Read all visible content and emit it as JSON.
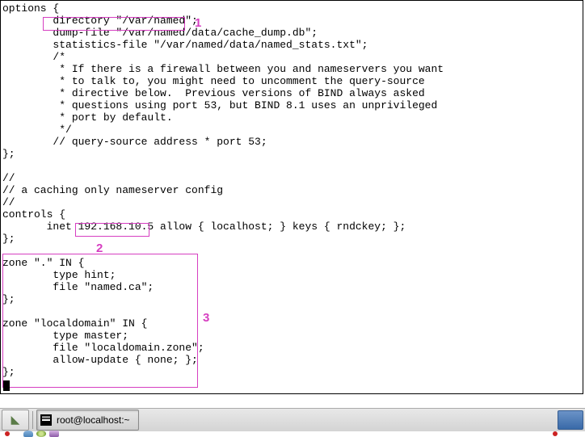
{
  "code_lines": [
    "options {",
    "        directory \"/var/named\";",
    "        dump-file \"/var/named/data/cache_dump.db\";",
    "        statistics-file \"/var/named/data/named_stats.txt\";",
    "        /*",
    "         * If there is a firewall between you and nameservers you want",
    "         * to talk to, you might need to uncomment the query-source",
    "         * directive below.  Previous versions of BIND always asked",
    "         * questions using port 53, but BIND 8.1 uses an unprivileged",
    "         * port by default.",
    "         */",
    "        // query-source address * port 53;",
    "};",
    "",
    "//",
    "// a caching only nameserver config",
    "//",
    "controls {",
    "       inet 192.168.10.5 allow { localhost; } keys { rndckey; };",
    "};",
    "",
    "zone \".\" IN {",
    "        type hint;",
    "        file \"named.ca\";",
    "};",
    "",
    "zone \"localdomain\" IN {",
    "        type master;",
    "        file \"localdomain.zone\";",
    "        allow-update { none; };",
    "};"
  ],
  "highlights": {
    "box1": {
      "text": "directory \"/var/named\";",
      "label": "1"
    },
    "box2": {
      "text": "192.168.10.5",
      "label": "2"
    },
    "box3": {
      "label": "3"
    }
  },
  "taskbar": {
    "window_title": "root@localhost:~"
  },
  "annotation_labels": {
    "a1": "1",
    "a2": "2",
    "a3": "3"
  }
}
